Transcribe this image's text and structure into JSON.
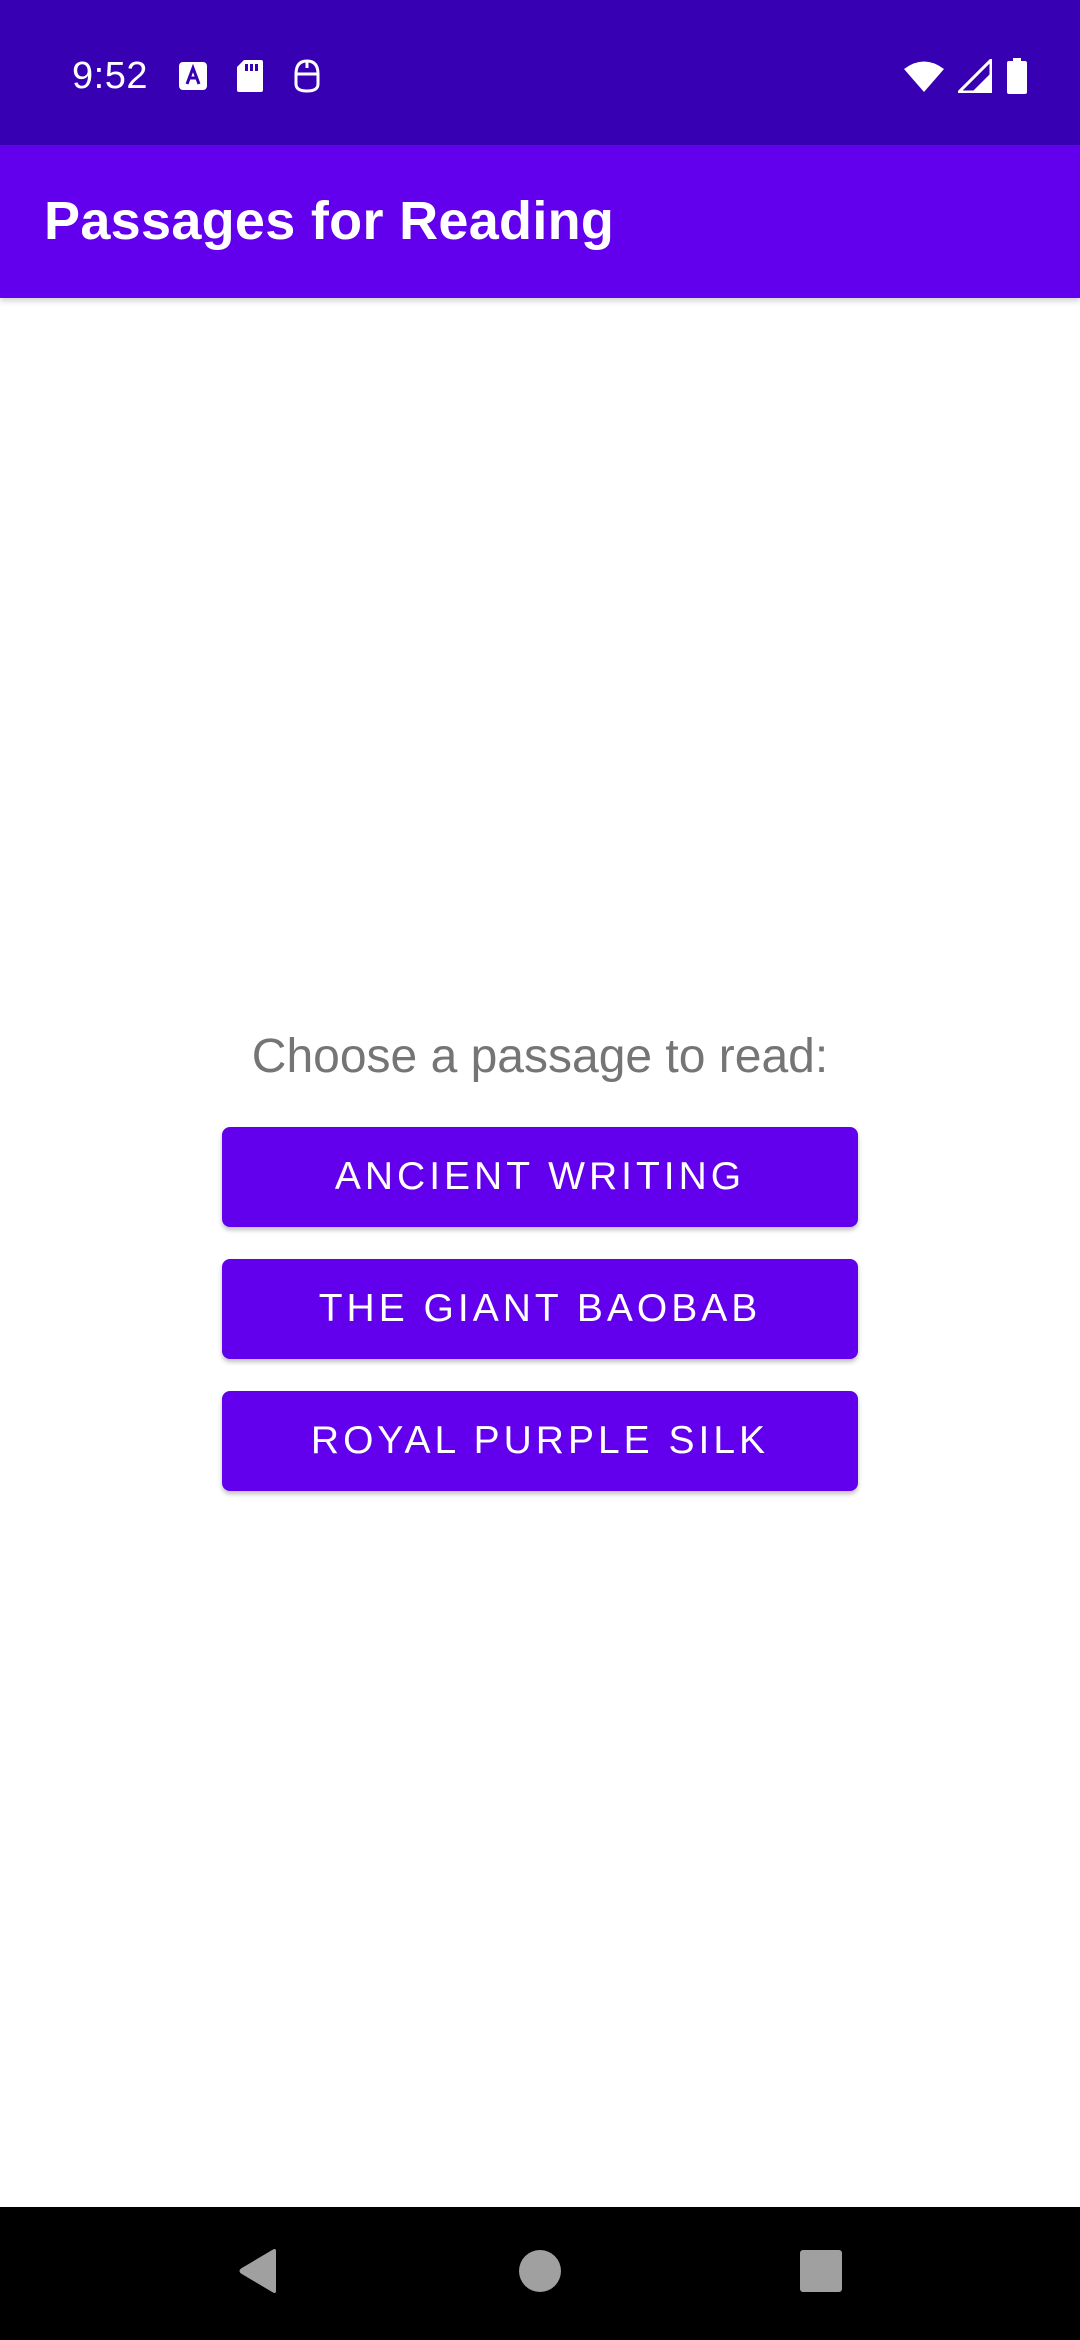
{
  "status_bar": {
    "time": "9:52",
    "left_icons": [
      "a-badge-icon",
      "sd-card-icon",
      "helmet-icon"
    ],
    "right_icons": [
      "wifi-icon",
      "cell-signal-icon",
      "battery-icon"
    ],
    "background": "#3700b3"
  },
  "app_bar": {
    "title": "Passages for Reading",
    "background": "#6200ee"
  },
  "main": {
    "prompt": "Choose a passage to read:",
    "buttons": [
      {
        "label": "ANCIENT WRITING"
      },
      {
        "label": "THE GIANT BAOBAB"
      },
      {
        "label": "ROYAL PURPLE SILK"
      }
    ],
    "button_color": "#6200ee",
    "prompt_color": "#757575"
  },
  "nav_bar": {
    "buttons": [
      "back-icon",
      "home-icon",
      "recents-icon"
    ],
    "background": "#000000"
  }
}
